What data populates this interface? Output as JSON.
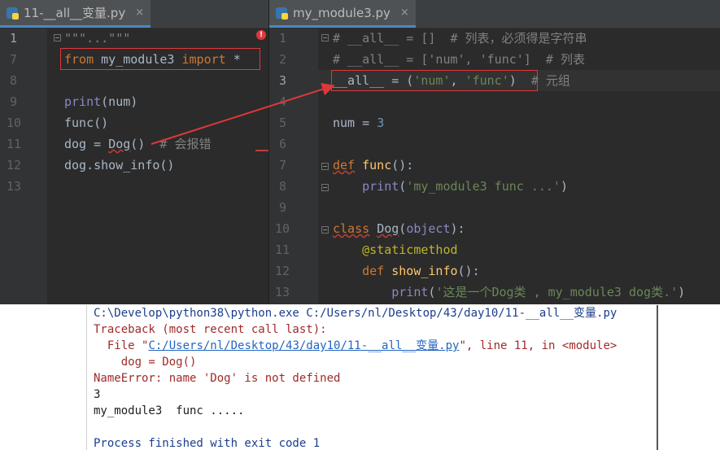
{
  "left_editor": {
    "tab": {
      "title": "11-__all__变量.py",
      "close": "×"
    },
    "line_numbers": [
      "1",
      "7",
      "8",
      "9",
      "10",
      "11",
      "12",
      "13"
    ],
    "lines": {
      "l1": "\"\"\"...\"\"\"",
      "l7_from": "from",
      "l7_mod": " my_module3 ",
      "l7_import": "import",
      "l7_star": " *",
      "l9_print": "print",
      "l9_rest": "(num)",
      "l10": "func()",
      "l11_a": "dog = ",
      "l11_dog": "Dog",
      "l11_b": "()  ",
      "l11_comment": "# 会报错",
      "l12": "dog.show_info()"
    },
    "error_icon": "!"
  },
  "right_editor": {
    "tab": {
      "title": "my_module3.py",
      "close": "×"
    },
    "line_numbers": [
      "1",
      "2",
      "3",
      "4",
      "5",
      "6",
      "7",
      "8",
      "9",
      "10",
      "11",
      "12",
      "13"
    ],
    "lines": {
      "l1": "# __all__ = []  # 列表，必须得是字符串",
      "l2": "# __all__ = ['num', 'func']  # 列表",
      "l3_a": "__all__ = (",
      "l3_s1": "'num'",
      "l3_b": ", ",
      "l3_s2": "'func'",
      "l3_c": ")",
      "l3_comment": "  # 元组",
      "l5_a": "num = ",
      "l5_num": "3",
      "l7_def": "def",
      "l7_sp": " ",
      "l7_name": "func",
      "l7_rest": "():",
      "l8_ind": "    ",
      "l8_print": "print",
      "l8_a": "(",
      "l8_str": "'my_module3 func ...'",
      "l8_b": ")",
      "l10_class": "class",
      "l10_sp": " ",
      "l10_name": "Dog",
      "l10_a": "(",
      "l10_obj": "object",
      "l10_b": "):",
      "l11_ind": "    ",
      "l11_dec": "@staticmethod",
      "l12_ind": "    ",
      "l12_def": "def",
      "l12_sp": " ",
      "l12_name": "show_info",
      "l12_rest": "():",
      "l13_ind": "        ",
      "l13_print": "print",
      "l13_a": "(",
      "l13_str": "'这是一个Dog类 , my_module3 dog类.'",
      "l13_b": ")"
    }
  },
  "console": {
    "cmd": "C:\\Develop\\python38\\python.exe C:/Users/nl/Desktop/43/day10/11-__all__变量.py",
    "traceback": "Traceback (most recent call last):",
    "file_prefix": "  File \"",
    "file_link": "C:/Users/nl/Desktop/43/day10/11-__all__变量.py",
    "file_suffix": "\", line 11, in <module>",
    "code_line": "    dog = Dog()",
    "error": "NameError: name 'Dog' is not defined",
    "out1": "3",
    "out2": "my_module3  func .....",
    "finished": "Process finished with exit code 1"
  },
  "colors": {
    "editor_bg": "#2b2b2b",
    "keyword": "#cc7832",
    "string": "#6a8759",
    "annotation_red": "#e0373a"
  }
}
